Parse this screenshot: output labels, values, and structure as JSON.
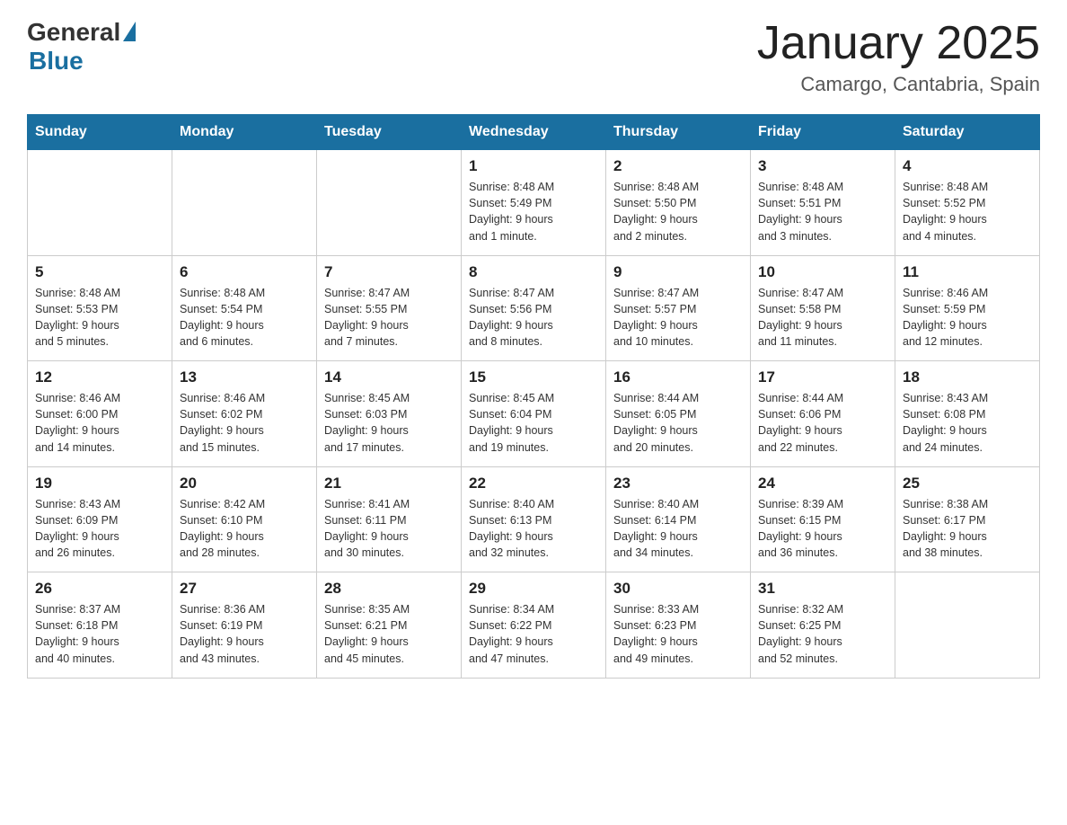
{
  "logo": {
    "general": "General",
    "blue": "Blue"
  },
  "header": {
    "title": "January 2025",
    "subtitle": "Camargo, Cantabria, Spain"
  },
  "days_of_week": [
    "Sunday",
    "Monday",
    "Tuesday",
    "Wednesday",
    "Thursday",
    "Friday",
    "Saturday"
  ],
  "weeks": [
    [
      {
        "day": "",
        "info": ""
      },
      {
        "day": "",
        "info": ""
      },
      {
        "day": "",
        "info": ""
      },
      {
        "day": "1",
        "info": "Sunrise: 8:48 AM\nSunset: 5:49 PM\nDaylight: 9 hours\nand 1 minute."
      },
      {
        "day": "2",
        "info": "Sunrise: 8:48 AM\nSunset: 5:50 PM\nDaylight: 9 hours\nand 2 minutes."
      },
      {
        "day": "3",
        "info": "Sunrise: 8:48 AM\nSunset: 5:51 PM\nDaylight: 9 hours\nand 3 minutes."
      },
      {
        "day": "4",
        "info": "Sunrise: 8:48 AM\nSunset: 5:52 PM\nDaylight: 9 hours\nand 4 minutes."
      }
    ],
    [
      {
        "day": "5",
        "info": "Sunrise: 8:48 AM\nSunset: 5:53 PM\nDaylight: 9 hours\nand 5 minutes."
      },
      {
        "day": "6",
        "info": "Sunrise: 8:48 AM\nSunset: 5:54 PM\nDaylight: 9 hours\nand 6 minutes."
      },
      {
        "day": "7",
        "info": "Sunrise: 8:47 AM\nSunset: 5:55 PM\nDaylight: 9 hours\nand 7 minutes."
      },
      {
        "day": "8",
        "info": "Sunrise: 8:47 AM\nSunset: 5:56 PM\nDaylight: 9 hours\nand 8 minutes."
      },
      {
        "day": "9",
        "info": "Sunrise: 8:47 AM\nSunset: 5:57 PM\nDaylight: 9 hours\nand 10 minutes."
      },
      {
        "day": "10",
        "info": "Sunrise: 8:47 AM\nSunset: 5:58 PM\nDaylight: 9 hours\nand 11 minutes."
      },
      {
        "day": "11",
        "info": "Sunrise: 8:46 AM\nSunset: 5:59 PM\nDaylight: 9 hours\nand 12 minutes."
      }
    ],
    [
      {
        "day": "12",
        "info": "Sunrise: 8:46 AM\nSunset: 6:00 PM\nDaylight: 9 hours\nand 14 minutes."
      },
      {
        "day": "13",
        "info": "Sunrise: 8:46 AM\nSunset: 6:02 PM\nDaylight: 9 hours\nand 15 minutes."
      },
      {
        "day": "14",
        "info": "Sunrise: 8:45 AM\nSunset: 6:03 PM\nDaylight: 9 hours\nand 17 minutes."
      },
      {
        "day": "15",
        "info": "Sunrise: 8:45 AM\nSunset: 6:04 PM\nDaylight: 9 hours\nand 19 minutes."
      },
      {
        "day": "16",
        "info": "Sunrise: 8:44 AM\nSunset: 6:05 PM\nDaylight: 9 hours\nand 20 minutes."
      },
      {
        "day": "17",
        "info": "Sunrise: 8:44 AM\nSunset: 6:06 PM\nDaylight: 9 hours\nand 22 minutes."
      },
      {
        "day": "18",
        "info": "Sunrise: 8:43 AM\nSunset: 6:08 PM\nDaylight: 9 hours\nand 24 minutes."
      }
    ],
    [
      {
        "day": "19",
        "info": "Sunrise: 8:43 AM\nSunset: 6:09 PM\nDaylight: 9 hours\nand 26 minutes."
      },
      {
        "day": "20",
        "info": "Sunrise: 8:42 AM\nSunset: 6:10 PM\nDaylight: 9 hours\nand 28 minutes."
      },
      {
        "day": "21",
        "info": "Sunrise: 8:41 AM\nSunset: 6:11 PM\nDaylight: 9 hours\nand 30 minutes."
      },
      {
        "day": "22",
        "info": "Sunrise: 8:40 AM\nSunset: 6:13 PM\nDaylight: 9 hours\nand 32 minutes."
      },
      {
        "day": "23",
        "info": "Sunrise: 8:40 AM\nSunset: 6:14 PM\nDaylight: 9 hours\nand 34 minutes."
      },
      {
        "day": "24",
        "info": "Sunrise: 8:39 AM\nSunset: 6:15 PM\nDaylight: 9 hours\nand 36 minutes."
      },
      {
        "day": "25",
        "info": "Sunrise: 8:38 AM\nSunset: 6:17 PM\nDaylight: 9 hours\nand 38 minutes."
      }
    ],
    [
      {
        "day": "26",
        "info": "Sunrise: 8:37 AM\nSunset: 6:18 PM\nDaylight: 9 hours\nand 40 minutes."
      },
      {
        "day": "27",
        "info": "Sunrise: 8:36 AM\nSunset: 6:19 PM\nDaylight: 9 hours\nand 43 minutes."
      },
      {
        "day": "28",
        "info": "Sunrise: 8:35 AM\nSunset: 6:21 PM\nDaylight: 9 hours\nand 45 minutes."
      },
      {
        "day": "29",
        "info": "Sunrise: 8:34 AM\nSunset: 6:22 PM\nDaylight: 9 hours\nand 47 minutes."
      },
      {
        "day": "30",
        "info": "Sunrise: 8:33 AM\nSunset: 6:23 PM\nDaylight: 9 hours\nand 49 minutes."
      },
      {
        "day": "31",
        "info": "Sunrise: 8:32 AM\nSunset: 6:25 PM\nDaylight: 9 hours\nand 52 minutes."
      },
      {
        "day": "",
        "info": ""
      }
    ]
  ]
}
